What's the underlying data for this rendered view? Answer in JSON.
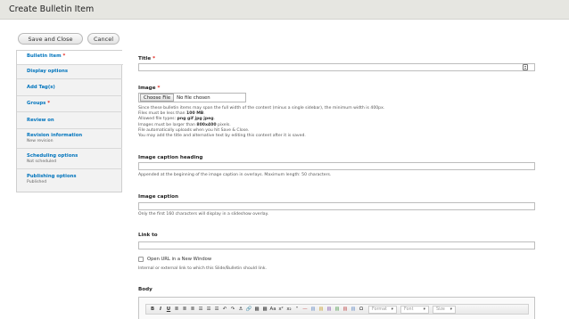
{
  "header": {
    "title": "Create Bulletin Item"
  },
  "actions": {
    "save_label": "Save and Close",
    "cancel_label": "Cancel"
  },
  "tabs": [
    {
      "label": "Bulletin Item",
      "required": true,
      "summary": ""
    },
    {
      "label": "Display options",
      "required": false,
      "summary": ""
    },
    {
      "label": "Add Tag(s)",
      "required": false,
      "summary": ""
    },
    {
      "label": "Groups",
      "required": true,
      "summary": ""
    },
    {
      "label": "Review on",
      "required": false,
      "summary": ""
    },
    {
      "label": "Revision information",
      "required": false,
      "summary": "New revision"
    },
    {
      "label": "Scheduling options",
      "required": false,
      "summary": "Not scheduled"
    },
    {
      "label": "Publishing options",
      "required": false,
      "summary": "Published"
    }
  ],
  "form": {
    "title_label": "Title",
    "image_label": "Image",
    "file_button": "Choose File",
    "file_status": "No file chosen",
    "image_help": {
      "line1": "Since these bulletin items may span the full width of the content (minus a single sidebar), the minimum width is 400px.",
      "line2_prefix": "Files must be less than ",
      "line2_value": "100 MB",
      "line2_suffix": ".",
      "line3_prefix": "Allowed file types: ",
      "line3_value": "png gif jpg jpeg",
      "line3_suffix": ".",
      "line4_prefix": "Images must be larger than ",
      "line4_value": "800x400",
      "line4_suffix": " pixels.",
      "line5": "File automatically uploads when you hit Save & Close.",
      "line6": "You may add the title and alternative text by editing this content after it is saved."
    },
    "caption_heading_label": "Image caption heading",
    "caption_heading_help": "Appended at the beginning of the image caption in overlays. Maximum length: 50 characters.",
    "caption_label": "Image caption",
    "caption_help": "Only the first 160 characters will display in a slideshow overlay.",
    "link_label": "Link to",
    "new_window_label": "Open URL in a New Window",
    "link_help": "Internal or external link to which this Slide/Bulletin should link.",
    "body_label": "Body"
  },
  "editor": {
    "buttons": [
      "B",
      "I",
      "U",
      "≣",
      "≣",
      "≣",
      "☰",
      "☰",
      "☰",
      "↶",
      "↷",
      "⚓",
      "🔗",
      "▦",
      "▦",
      "Aa",
      "x²",
      "x₂",
      "“",
      "—",
      "▤",
      "▤",
      "▤",
      "▤",
      "▤",
      "▤",
      "Ω"
    ],
    "icon_colors": [
      "#6a8fc9",
      "#c9a43b",
      "#8a5fb0",
      "#5aa05a",
      "#c05050"
    ],
    "format_placeholder": "Format",
    "font_placeholder": "Font",
    "size_placeholder": "Size"
  }
}
